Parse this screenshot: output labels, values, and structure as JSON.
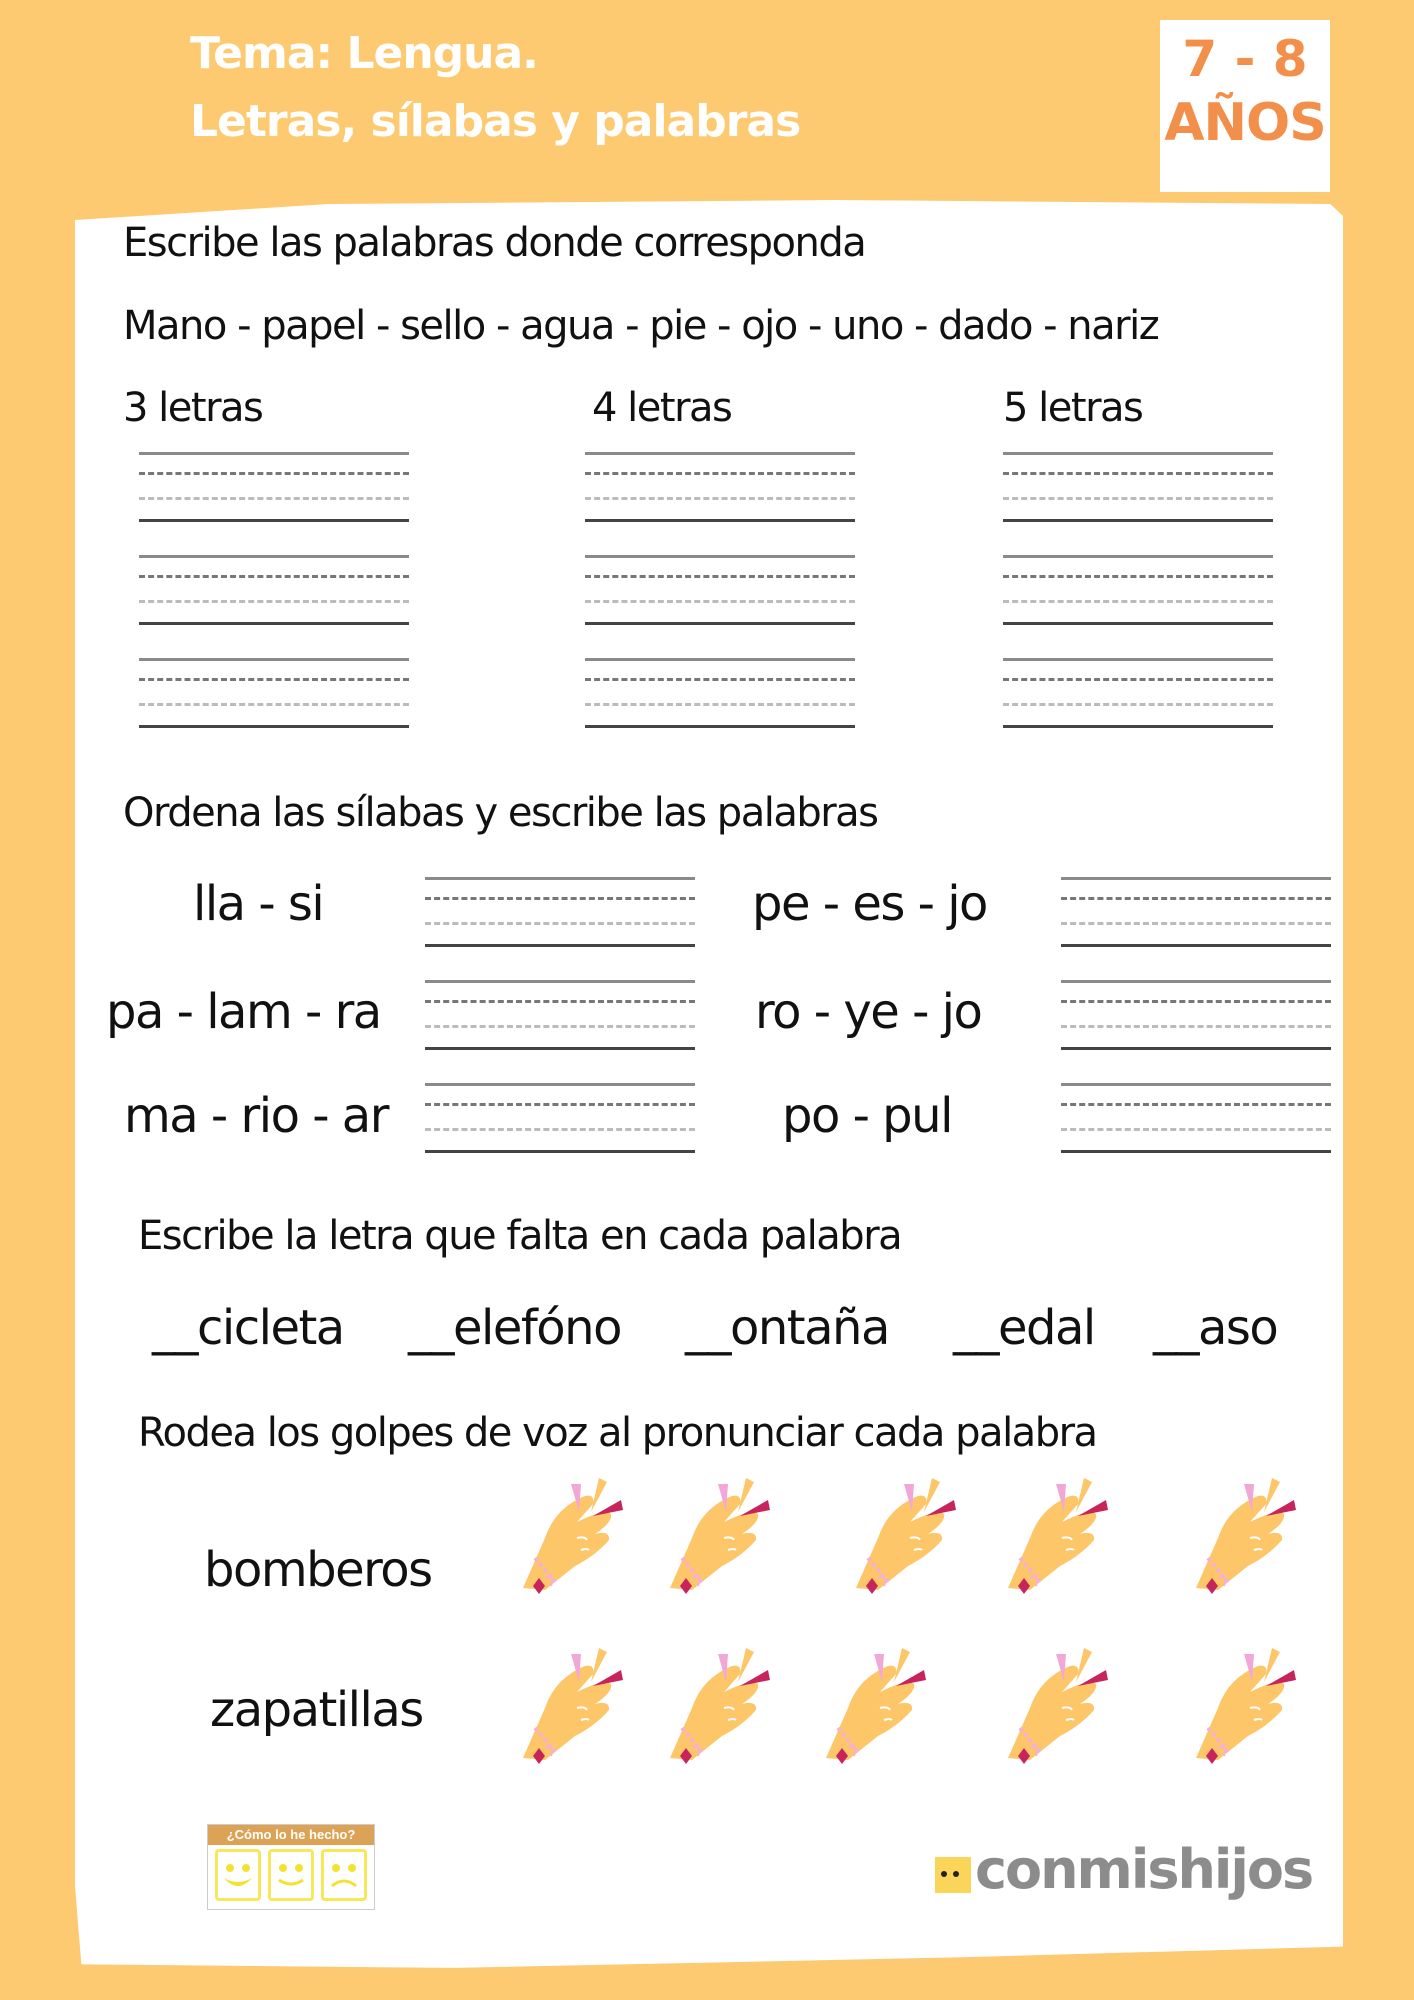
{
  "header": {
    "title_line1": "Tema: Lengua.",
    "title_line2": "Letras, sílabas y palabras",
    "age_range": "7 - 8",
    "age_unit": "AÑOS",
    "accent_color": "#f28f4a",
    "background_color": "#fdc971"
  },
  "exercise1": {
    "instruction": "Escribe las palabras donde corresponda",
    "word_list": "Mano - papel - sello - agua - pie - ojo - uno - dado - nariz",
    "columns": [
      {
        "label": "3 letras"
      },
      {
        "label": "4 letras"
      },
      {
        "label": "5 letras"
      }
    ]
  },
  "exercise2": {
    "instruction": "Ordena las sílabas y escribe las palabras",
    "left_items": [
      "lla - si",
      "pa - lam - ra",
      "ma - rio - ar"
    ],
    "right_items": [
      "pe - es - jo",
      "ro - ye - jo",
      "po - pul"
    ]
  },
  "exercise3": {
    "instruction": "Escribe la letra que falta en cada palabra",
    "words": [
      "__cicleta",
      "__elefóno",
      "__ontaña",
      "__edal",
      "__aso"
    ]
  },
  "exercise4": {
    "instruction": "Rodea los golpes de voz al pronunciar cada palabra",
    "words": [
      {
        "word": "bomberos",
        "icon": "clapping-hand-icon",
        "icon_count": 5
      },
      {
        "word": "zapatillas",
        "icon": "clapping-hand-icon",
        "icon_count": 5
      }
    ]
  },
  "footer": {
    "rating_title": "¿Cómo lo he hecho?",
    "rating_faces": [
      "happy-face-icon",
      "neutral-smile-face-icon",
      "sad-face-icon"
    ],
    "brand": "conmishijos"
  }
}
